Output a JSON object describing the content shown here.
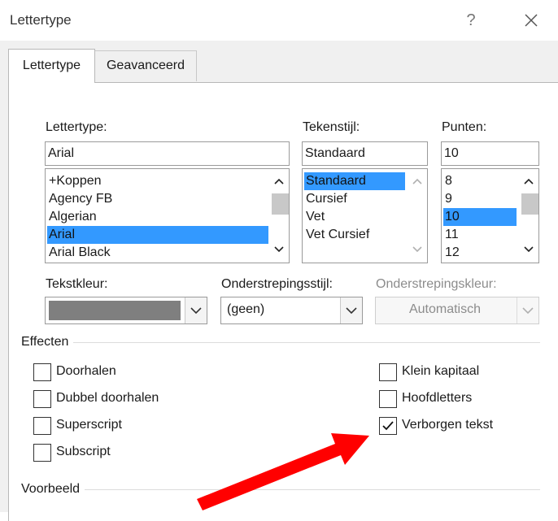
{
  "window": {
    "title": "Lettertype",
    "help_glyph": "?",
    "close_icon": "close-icon"
  },
  "tabs": [
    {
      "label": "Lettertype",
      "active": true
    },
    {
      "label": "Geavanceerd",
      "active": false
    }
  ],
  "font": {
    "label": "Lettertype:",
    "value": "Arial",
    "list": [
      "+Koppen",
      "Agency FB",
      "Algerian",
      "Arial",
      "Arial Black"
    ],
    "selected_index": 3
  },
  "style": {
    "label": "Tekenstijl:",
    "value": "Standaard",
    "list": [
      "Standaard",
      "Cursief",
      "Vet",
      "Vet Cursief"
    ],
    "selected_index": 0
  },
  "size": {
    "label": "Punten:",
    "value": "10",
    "list": [
      "8",
      "9",
      "10",
      "11",
      "12"
    ],
    "selected_index": 2
  },
  "font_color": {
    "label": "Tekstkleur:",
    "swatch_color": "#7f7f7f"
  },
  "underline_style": {
    "label": "Onderstrepingsstijl:",
    "value": "(geen)"
  },
  "underline_color": {
    "label": "Onderstrepingskleur:",
    "value": "Automatisch",
    "enabled": false
  },
  "effects": {
    "title": "Effecten",
    "left": [
      {
        "label": "Doorhalen",
        "checked": false
      },
      {
        "label": "Dubbel doorhalen",
        "checked": false
      },
      {
        "label": "Superscript",
        "checked": false
      },
      {
        "label": "Subscript",
        "checked": false
      }
    ],
    "right": [
      {
        "label": "Klein kapitaal",
        "checked": false
      },
      {
        "label": "Hoofdletters",
        "checked": false
      },
      {
        "label": "Verborgen tekst",
        "checked": true
      }
    ]
  },
  "preview": {
    "title": "Voorbeeld"
  },
  "colors": {
    "selection": "#3399ff",
    "annotation_arrow": "#ff0000"
  }
}
